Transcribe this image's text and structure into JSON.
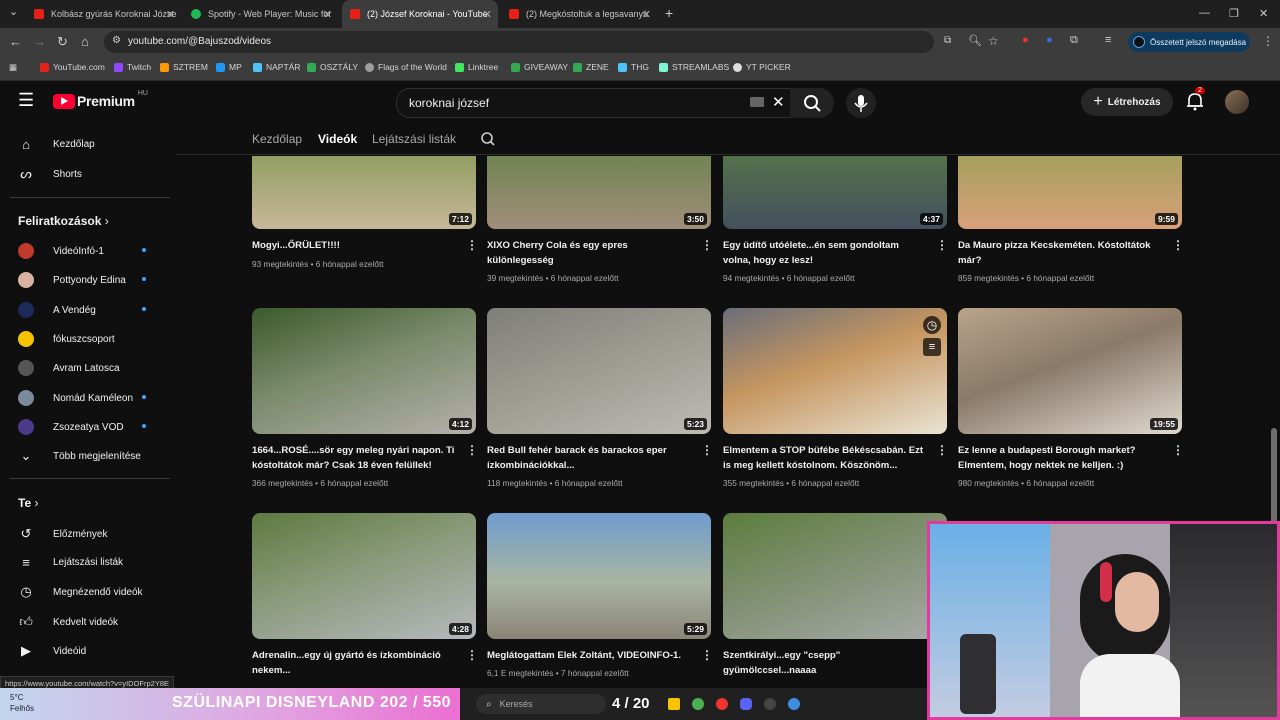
{
  "browser": {
    "tabs": [
      {
        "label": "Kolbász gyúrás Koroknai Józse",
        "fav": "#e62117"
      },
      {
        "label": "Spotify - Web Player: Music for",
        "fav": "#1db954"
      },
      {
        "label": "(2) József Koroknai - YouTube",
        "fav": "#e62117"
      },
      {
        "label": "(2) Megkóstoltuk a legsavanyú",
        "fav": "#e62117"
      }
    ],
    "url": "youtube.com/@Bajuszod/videos",
    "password_button": "Összetett jelszó megadása",
    "bookmarks": [
      {
        "label": "YouTube.com",
        "color": "#e62117"
      },
      {
        "label": "Twitch",
        "color": "#9146ff"
      },
      {
        "label": "SZTREM",
        "color": "#ff9900"
      },
      {
        "label": "MP",
        "color": "#2196f3"
      },
      {
        "label": "NAPTÁR",
        "color": "#4fc3f7"
      },
      {
        "label": "OSZTÁLY",
        "color": "#34a853"
      },
      {
        "label": "Flags of the World",
        "color": "#9e9e9e"
      },
      {
        "label": "Linktree",
        "color": "#43e660"
      },
      {
        "label": "GIVEAWAY",
        "color": "#34a853"
      },
      {
        "label": "ZENE",
        "color": "#34a853"
      },
      {
        "label": "THG",
        "color": "#4fc3f7"
      },
      {
        "label": "STREAMLABS",
        "color": "#80f5d2"
      },
      {
        "label": "YT PICKER",
        "color": "#dddddd"
      }
    ]
  },
  "youtube": {
    "logo_text": "Premium",
    "region": "HU",
    "search_query": "koroknai józsef",
    "create_label": "Létrehozás",
    "notif_count": "2"
  },
  "sidebar": {
    "home": "Kezdőlap",
    "shorts": "Shorts",
    "subs_header": "Feliratkozások",
    "subs": [
      {
        "label": "VideóInfó-1",
        "color": "#c0392b"
      },
      {
        "label": "Pottyondy Edina",
        "color": "#d7b3a0"
      },
      {
        "label": "A Vendég",
        "color": "#1d2a5c"
      },
      {
        "label": "fókuszcsoport",
        "color": "#f5c400"
      },
      {
        "label": "Avram Latosca",
        "color": "#555555"
      },
      {
        "label": "Nomád Kaméleon",
        "color": "#7a8a9a"
      },
      {
        "label": "Zsozeatya VOD",
        "color": "#4a3a8a"
      }
    ],
    "more_label": "Több megjelenítése",
    "you_header": "Te",
    "you_items": [
      "Előzmények",
      "Lejátszási listák",
      "Megnézendő videók",
      "Kedvelt videók",
      "Videóid"
    ]
  },
  "channel_tabs": [
    "Kezdőlap",
    "Videók",
    "Lejátszási listák"
  ],
  "videos": [
    {
      "title": "Mogyi...ŐRÜLET!!!!",
      "meta": "93 megtekintés • 6 hónappal ezelőtt",
      "dur": "7:12",
      "c1": "#6b8c3a",
      "c2": "#c7b79a"
    },
    {
      "title": "XIXO Cherry Cola és egy epres különlegesség",
      "meta": "39 megtekintés • 6 hónappal ezelőtt",
      "dur": "3:50",
      "c1": "#4f7d38",
      "c2": "#a08d7a"
    },
    {
      "title": "Egy üdítő utóélete...én sem gondoltam volna, hogy ez lesz!",
      "meta": "94 megtekintés • 6 hónappal ezelőtt",
      "dur": "4:37",
      "c1": "#5e8b3f",
      "c2": "#44505e"
    },
    {
      "title": "Da Mauro pizza Kecskeméten. Kóstoltátok már?",
      "meta": "859 megtekintés • 6 hónappal ezelőtt",
      "dur": "9:59",
      "c1": "#7fa04a",
      "c2": "#d9a07a"
    },
    {
      "title": "1664...ROSÉ....sör egy meleg nyári napon. Ti kóstoltátok már? Csak 18 éven felülIek!",
      "meta": "366 megtekintés • 6 hónappal ezelőtt",
      "dur": "4:12",
      "c1": "#3b5a2c",
      "c2": "#b5b0ab"
    },
    {
      "title": "Red Bull fehér barack és barackos eper ízkombinációkkal...",
      "meta": "118 megtekintés • 6 hónappal ezelőtt",
      "dur": "5:23",
      "c1": "#7f7f7a",
      "c2": "#bdbab3"
    },
    {
      "title": "Elmentem a STOP büfébe Békéscsabán. Ezt is meg kellett kóstolnom. Köszönöm...",
      "meta": "355 megtekintés • 6 hónappal ezelőtt",
      "dur": "",
      "c1": "#c69660",
      "c2": "#e9e3d4"
    },
    {
      "title": "Ez lenne a budapesti Borough market? Elmentem, hogy nektek ne kelljen. :)",
      "meta": "980 megtekintés • 6 hónappal ezelőtt",
      "dur": "19:55",
      "c1": "#b8a48a",
      "c2": "#e0d9cf"
    },
    {
      "title": "Adrenalin...egy új gyártó és ízkombináció nekem...",
      "meta": "",
      "dur": "4:28",
      "c1": "#5d7a40",
      "c2": "#b6b8bd"
    },
    {
      "title": "Meglátogattam Elek Zoltánt, VIDEOINFO-1.",
      "meta": "6,1 E megtekintés • 7 hónappal ezelőtt",
      "dur": "5:29",
      "c1": "#6f9ccf",
      "c2": "#8a8478"
    },
    {
      "title": "Szentkirályi...egy \"csepp\" gyümölccsel...naaaa",
      "meta": "",
      "dur": "",
      "c1": "#5c7d3e",
      "c2": "#a7aaa8"
    }
  ],
  "overlay": {
    "banner": "SZÜLINAPI DISNEYLAND  202 / 550",
    "weather_temp": "5°C",
    "weather_desc": "Felhős",
    "taskbar_search": "Keresés",
    "counter": "4 / 20",
    "status_url": "https://www.youtube.com/watch?v=yIDOFrp2Y8E"
  }
}
